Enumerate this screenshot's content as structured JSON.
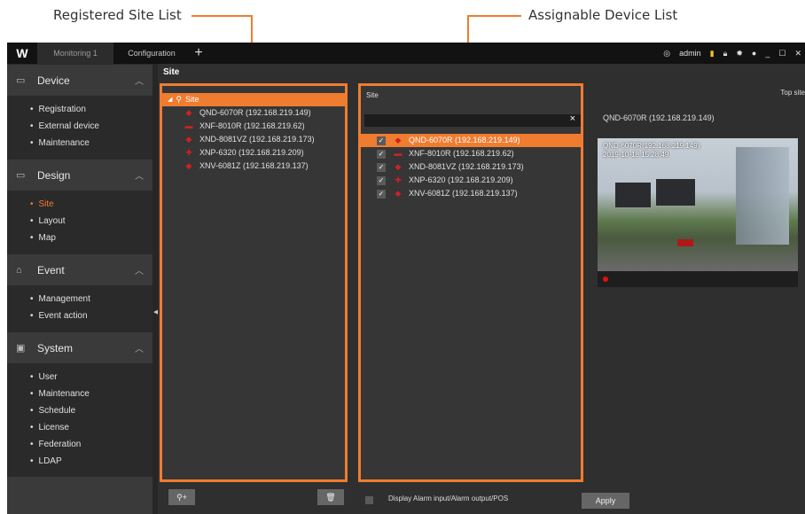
{
  "annotations": {
    "registered": "Registered Site List",
    "assignable": "Assignable Device List"
  },
  "topbar": {
    "logo": "W",
    "tabs": [
      "Monitoring 1",
      "Configuration"
    ],
    "plus": "+",
    "user": "admin",
    "icons": [
      "user-icon",
      "signal-icon",
      "lock-icon",
      "gear-icon",
      "info-icon",
      "minimize-icon",
      "maximize-icon",
      "close-icon"
    ]
  },
  "sidebar": {
    "sections": [
      {
        "title": "Device",
        "items": [
          "Registration",
          "External device",
          "Maintenance"
        ]
      },
      {
        "title": "Design",
        "items": [
          "Site",
          "Layout",
          "Map"
        ],
        "active_item": "Site"
      },
      {
        "title": "Event",
        "items": [
          "Management",
          "Event action"
        ]
      },
      {
        "title": "System",
        "items": [
          "User",
          "Maintenance",
          "Schedule",
          "License",
          "Federation",
          "LDAP"
        ]
      }
    ]
  },
  "main": {
    "title": "Site",
    "registered_root": "Site",
    "registered_devices": [
      "QND-6070R (192.168.219.149)",
      "XNF-8010R (192.168.219.62)",
      "XND-8081VZ (192.168.219.173)",
      "XNP-6320 (192.168.219.209)",
      "XNV-6081Z (192.168.219.137)"
    ],
    "assignable_label": "Site",
    "search_clear": "×",
    "assignable_devices": [
      "QND-6070R (192.168.219.149)",
      "XNF-8010R (192.168.219.62)",
      "XND-8081VZ (192.168.219.173)",
      "XNP-6320 (192.168.219.209)",
      "XNV-6081Z (192.168.219.137)"
    ],
    "top_site": "Top site",
    "selected_device": "QND-6070R (192.168.219.149)",
    "video_title": "QND-6070R(192.168.219.149)",
    "video_timestamp": "2019-10-18 15:28:49",
    "footer_checkbox": "Display Alarm input/Alarm output/POS",
    "apply": "Apply"
  }
}
